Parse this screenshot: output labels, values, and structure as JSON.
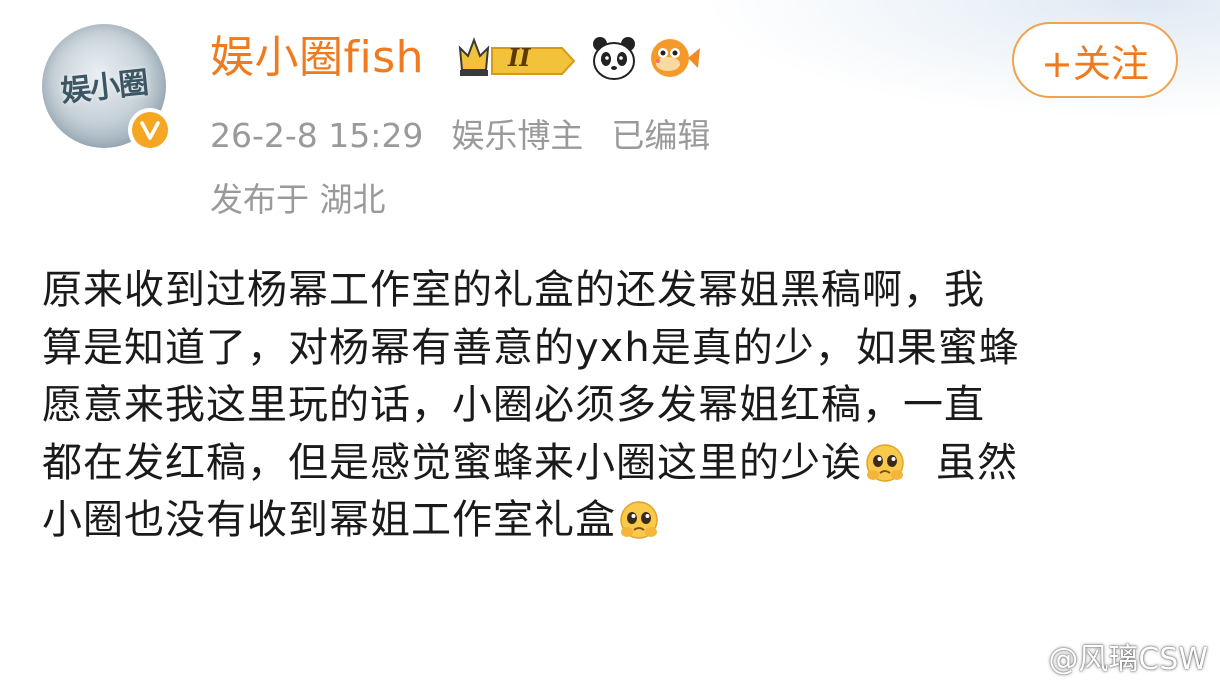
{
  "post": {
    "avatar_text": "娱小圈",
    "username": "娱小圈fish",
    "level_badge": "II",
    "follow_label": "+关注",
    "timestamp": "26-2-8 15:29",
    "user_category": "娱乐博主",
    "edited_label": "已编辑",
    "location_label": "发布于 湖北",
    "body_lines": [
      "原来收到过杨幂工作室的礼盒的还发幂姐黑稿啊，我",
      "算是知道了，对杨幂有善意的yxh是真的少，如果蜜蜂",
      "愿意来我这里玩的话，小圈必须多发幂姐红稿，一直",
      "都在发红稿，但是感觉蜜蜂来小圈这里的少诶",
      "虽然",
      "小圈也没有收到幂姐工作室礼盒"
    ]
  },
  "watermark": {
    "text": "@风璃CSW"
  },
  "colors": {
    "username": "#f07b1f",
    "follow_border": "#f0a24f",
    "meta_gray": "#9a9a9a",
    "verified": "#f5a623"
  },
  "icons": [
    "crown-level-badge-icon",
    "panda-icon",
    "pufferfish-icon",
    "verified-icon",
    "pleading-face-emoji-icon",
    "weibo-logo-icon"
  ]
}
